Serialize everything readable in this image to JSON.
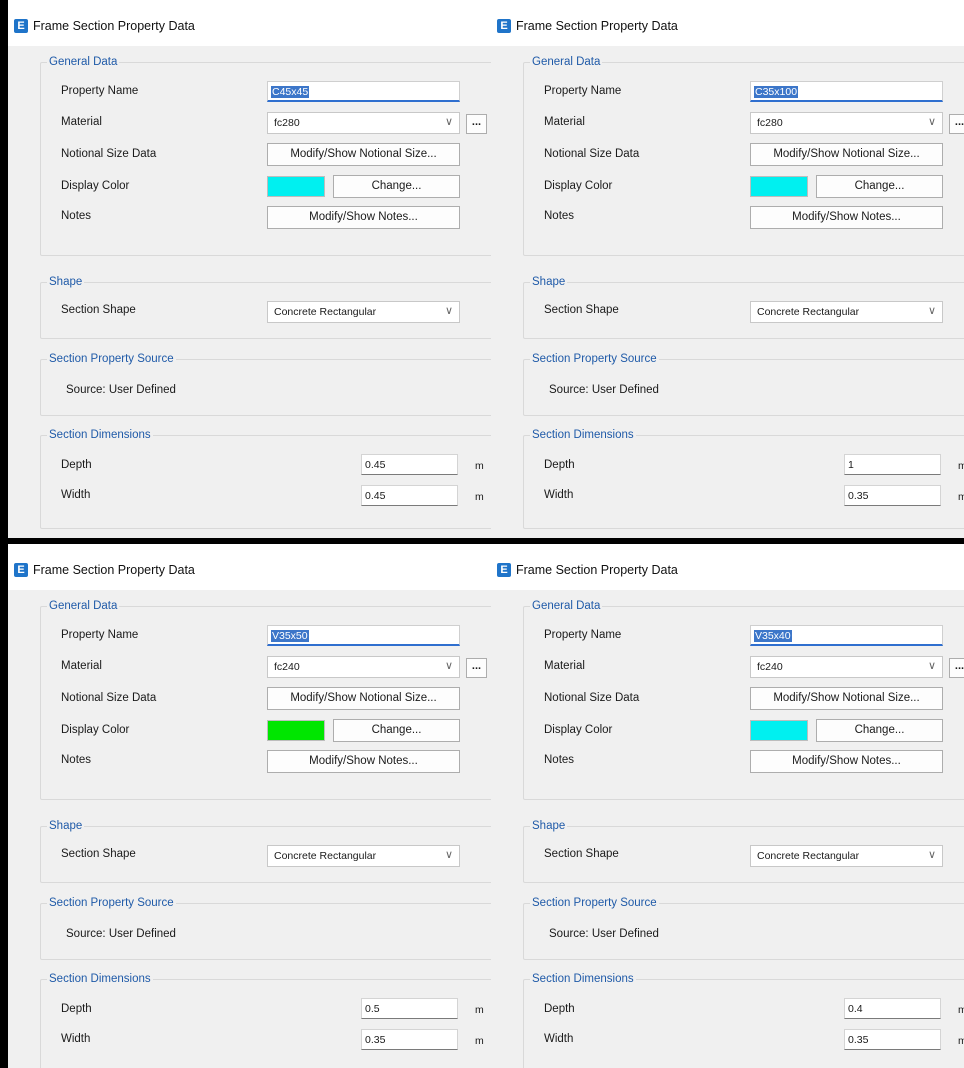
{
  "common": {
    "window_title": "Frame Section Property Data",
    "app_icon_glyph": "E",
    "general_data_label": "General Data",
    "property_name_label": "Property Name",
    "material_label": "Material",
    "notional_size_label": "Notional Size Data",
    "display_color_label": "Display Color",
    "notes_label": "Notes",
    "notional_button": "Modify/Show Notional Size...",
    "change_button": "Change...",
    "notes_button": "Modify/Show Notes...",
    "ellipsis_button": "...",
    "shape_label": "Shape",
    "section_shape_label": "Section Shape",
    "section_shape_value": "Concrete Rectangular",
    "source_group_label": "Section Property Source",
    "source_text": "Source:  User Defined",
    "dimensions_label": "Section Dimensions",
    "depth_label": "Depth",
    "width_label": "Width",
    "unit": "m",
    "dropdown_icon": "chevron-down-icon"
  },
  "panels": [
    {
      "property_name": "C45x45",
      "material": "fc280",
      "display_color": "#00f0f0",
      "depth": "0.45",
      "width": "0.45"
    },
    {
      "property_name": "C35x100",
      "material": "fc280",
      "display_color": "#00f0f0",
      "depth": "1",
      "width": "0.35"
    },
    {
      "property_name": "V35x50",
      "material": "fc240",
      "display_color": "#00e600",
      "depth": "0.5",
      "width": "0.35"
    },
    {
      "property_name": "V35x40",
      "material": "fc240",
      "display_color": "#00f0f0",
      "depth": "0.4",
      "width": "0.35"
    }
  ]
}
